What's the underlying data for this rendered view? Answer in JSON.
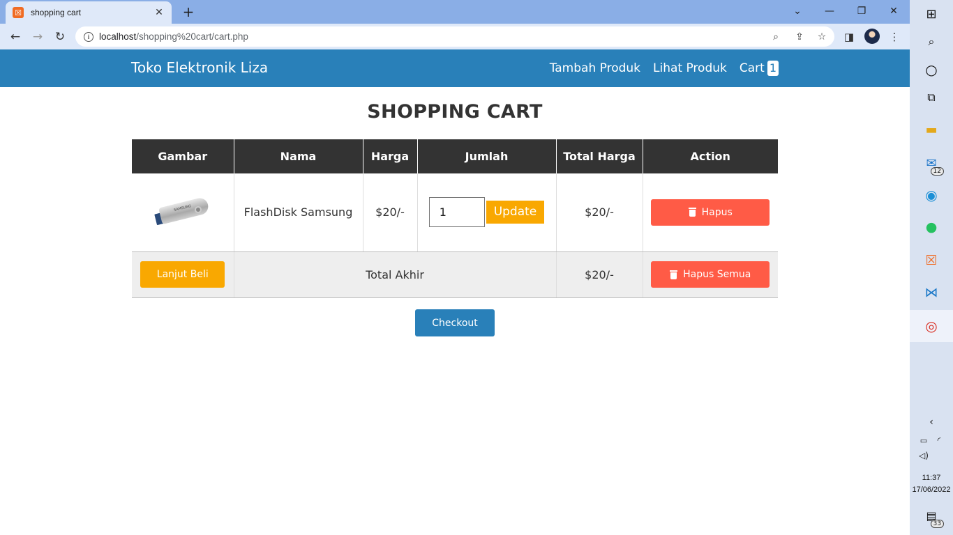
{
  "browser": {
    "tab_title": "shopping cart",
    "tab_close": "✕",
    "new_tab": "+",
    "url_host": "localhost",
    "url_path": "/shopping%20cart/cart.php",
    "window_controls": {
      "menu": "⌄",
      "minimize": "—",
      "restore": "❐",
      "close": "✕"
    }
  },
  "site": {
    "brand": "Toko Elektronik Liza",
    "nav": {
      "add_product": "Tambah Produk",
      "view_products": "Lihat Produk",
      "cart": "Cart",
      "cart_count": "1"
    }
  },
  "cart": {
    "heading": "SHOPPING CART",
    "columns": [
      "Gambar",
      "Nama",
      "Harga",
      "Jumlah",
      "Total Harga",
      "Action"
    ],
    "items": [
      {
        "image_label": "SAMSUNG",
        "name": "FlashDisk Samsung",
        "price": "$20/-",
        "quantity": "1",
        "total": "$20/-"
      }
    ],
    "update_label": "Update",
    "delete_label": "Hapus",
    "continue_label": "Lanjut Beli",
    "grand_total_label": "Total Akhir",
    "grand_total": "$20/-",
    "delete_all_label": "Hapus Semua",
    "checkout_label": "Checkout"
  },
  "taskbar": {
    "mail_badge": "12",
    "notification_badge": "33",
    "time": "11:37",
    "date": "17/06/2022"
  },
  "colors": {
    "navbar": "#2980b9",
    "table_header": "#333333",
    "update_button": "#f9a801",
    "delete_button": "#ff5b46",
    "checkout_button": "#2980b9"
  }
}
